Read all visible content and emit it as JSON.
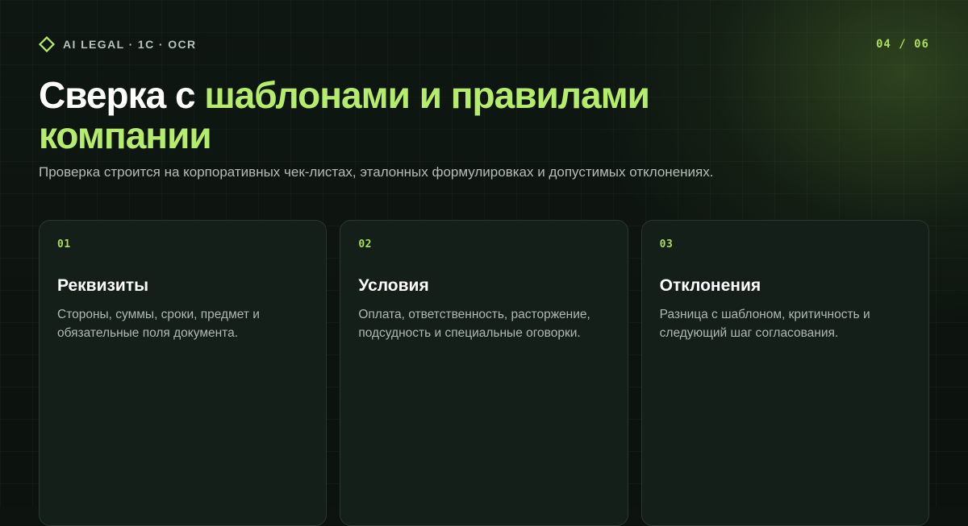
{
  "header": {
    "brand_label": "AI LEGAL · 1C · OCR",
    "brand_icon": "diamond-icon",
    "page_counter": "04 / 06"
  },
  "slide": {
    "title_plain": "Сверка с ",
    "title_accent": "шаблонами и правилами компании",
    "subtitle": "Проверка строится на корпоративных чек-листах, эталонных формулировках и допустимых отклонениях."
  },
  "cards": [
    {
      "number": "01",
      "title": "Реквизиты",
      "text": "Стороны, суммы, сроки, предмет и обязательные поля документа."
    },
    {
      "number": "02",
      "title": "Условия",
      "text": "Оплата, ответственность, расторжение, подсудность и специальные оговорки."
    },
    {
      "number": "03",
      "title": "Отклонения",
      "text": "Разница с шаблоном, критичность и следующий шаг согласования."
    }
  ],
  "colors": {
    "accent": "#b5ec6b",
    "background": "#0d130f",
    "card_background": "#141f1a"
  }
}
